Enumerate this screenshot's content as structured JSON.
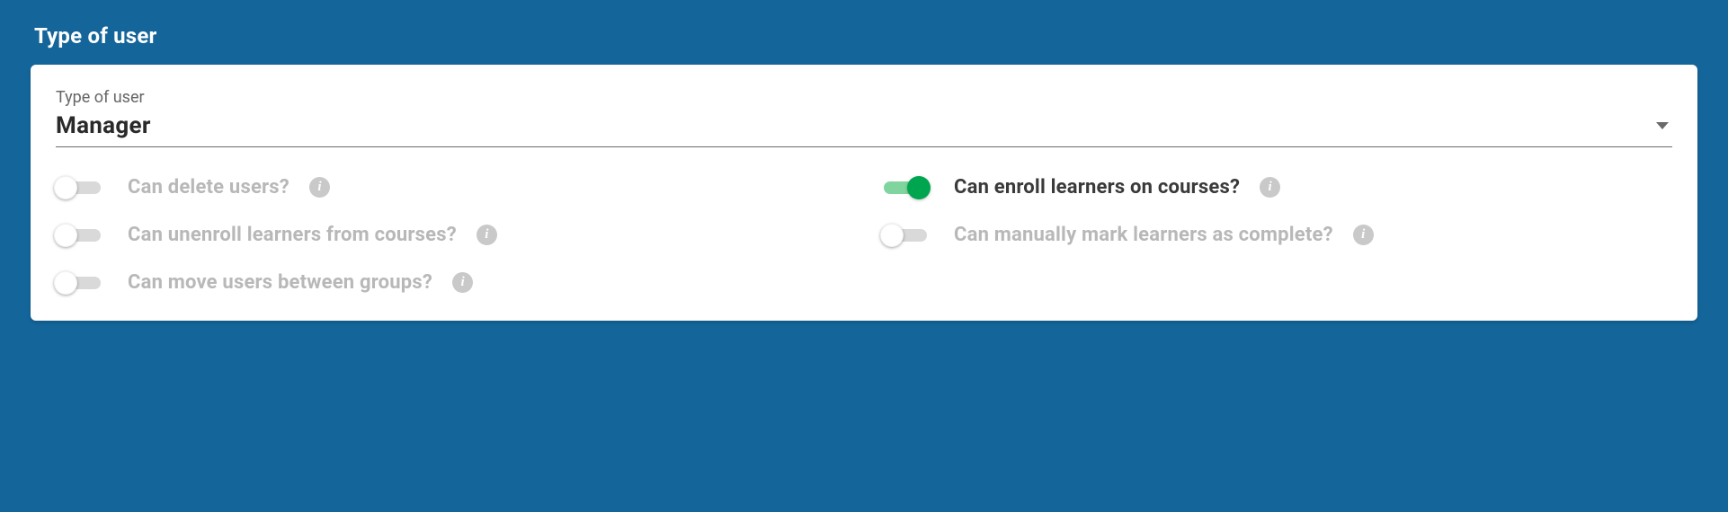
{
  "section_title": "Type of user",
  "field_label": "Type of user",
  "select_value": "Manager",
  "info_char": "i",
  "permissions": [
    {
      "label": "Can delete users?",
      "on": false
    },
    {
      "label": "Can enroll learners on courses?",
      "on": true
    },
    {
      "label": "Can unenroll learners from courses?",
      "on": false
    },
    {
      "label": "Can manually mark learners as complete?",
      "on": false
    },
    {
      "label": "Can move users between groups?",
      "on": false
    }
  ]
}
